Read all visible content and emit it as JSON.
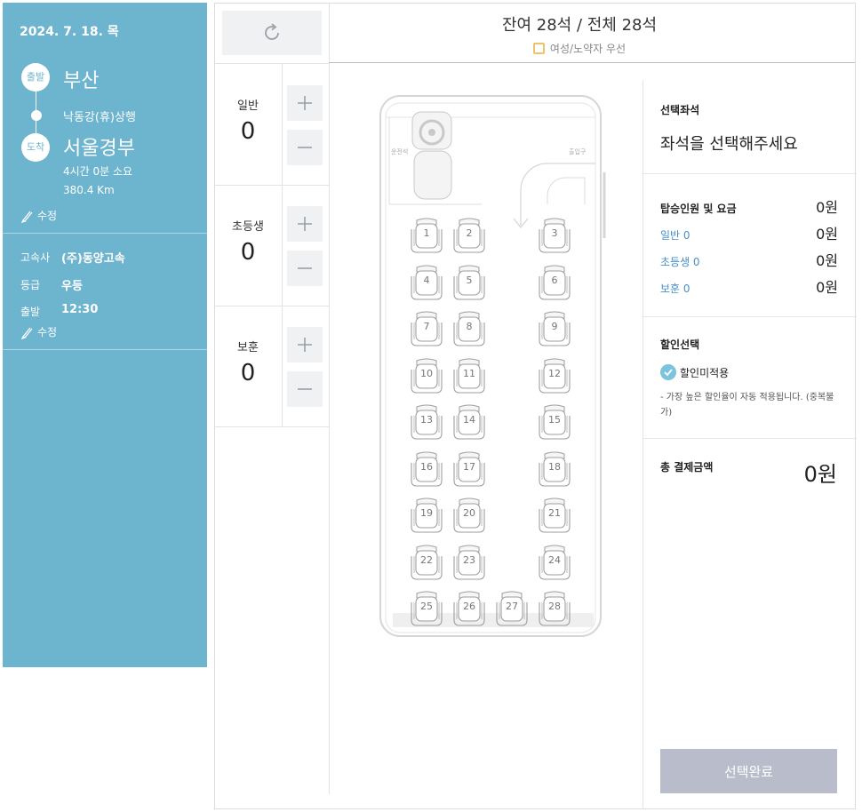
{
  "sidebar": {
    "date": "2024. 7. 18. 목",
    "depart_badge": "출발",
    "depart_city": "부산",
    "via": "낙동강(휴)상행",
    "arrive_badge": "도착",
    "arrive_city": "서울경부",
    "duration": "4시간 0분 소요",
    "distance": "380.4 Km",
    "edit_label": "수정",
    "company_label": "고속사",
    "company_value": "(주)동양고속",
    "grade_label": "등급",
    "grade_value": "우등",
    "time_label": "출발",
    "time_value": "12:30",
    "edit_label2": "수정"
  },
  "header": {
    "seat_count": "잔여 28석 / 전체 28석",
    "priority_label": "여성/노약자 우선"
  },
  "passengers": [
    {
      "label": "일반",
      "count": "0"
    },
    {
      "label": "초등생",
      "count": "0"
    },
    {
      "label": "보훈",
      "count": "0"
    }
  ],
  "bus": {
    "driver_label": "운전석",
    "door_label": "출입구",
    "seats": [
      "1",
      "2",
      "3",
      "4",
      "5",
      "6",
      "7",
      "8",
      "9",
      "10",
      "11",
      "12",
      "13",
      "14",
      "15",
      "16",
      "17",
      "18",
      "19",
      "20",
      "21",
      "22",
      "23",
      "24",
      "25",
      "26",
      "27",
      "28"
    ]
  },
  "right": {
    "selected_title": "선택좌석",
    "selected_placeholder": "좌석을 선택해주세요",
    "fare_title": "탑승인원 및 요금",
    "fare_total": "0원",
    "fares": [
      {
        "label": "일반 0",
        "amount": "0원"
      },
      {
        "label": "초등생 0",
        "amount": "0원"
      },
      {
        "label": "보훈 0",
        "amount": "0원"
      }
    ],
    "discount_title": "할인선택",
    "discount_option": "할인미적용",
    "discount_note": "- 가장 높은 할인율이 자동 적용됩니다. (중복불가)",
    "total_title": "총 결제금액",
    "total_amount": "0원",
    "complete_button": "선택완료"
  },
  "colors": {
    "sidebar_bg": "#6db4cf",
    "button_disabled": "#b9bdcb",
    "link": "#4a8fc7",
    "priority_border": "#f0c36b"
  },
  "icons": {
    "refresh": "refresh-icon",
    "plus": "plus-icon",
    "minus": "minus-icon",
    "edit": "pencil-icon",
    "check": "check-icon"
  }
}
